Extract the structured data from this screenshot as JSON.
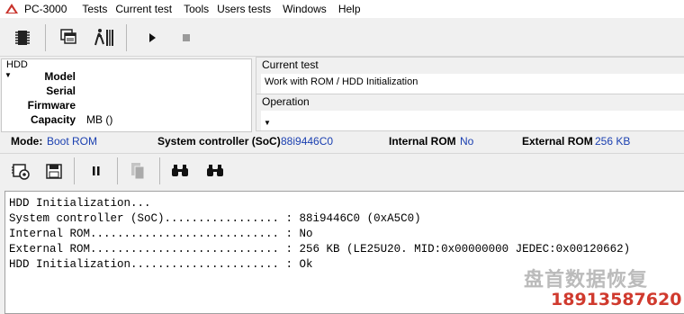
{
  "menubar": {
    "app_name": "PC-3000",
    "items": [
      "Tests",
      "Current test",
      "Tools",
      "Users tests",
      "Windows",
      "Help"
    ]
  },
  "toolbar1": {
    "icons": [
      "chip-icon",
      "windows-icon",
      "run-man-icon",
      "play-icon",
      "stop-icon"
    ]
  },
  "hdd": {
    "title": "HDD",
    "model_label": "Model",
    "serial_label": "Serial",
    "firmware_label": "Firmware",
    "capacity_label": "Capacity",
    "capacity_value": "MB ()"
  },
  "current_test": {
    "legend": "Current test",
    "value": "Work with ROM / HDD Initialization"
  },
  "operation": {
    "legend": "Operation"
  },
  "status": {
    "mode_label": "Mode:",
    "mode_value": "Boot ROM",
    "soc_label": "System controller (SoC)",
    "soc_value": "88i9446C0",
    "irom_label": "Internal ROM",
    "irom_value": "No",
    "erom_label": "External ROM",
    "erom_value": "256 KB"
  },
  "toolbar2": {
    "icons": [
      "settings-chip-icon",
      "disk-save-icon",
      "pause-icon",
      "copy-icon",
      "binoculars-icon",
      "binoculars-2-icon"
    ]
  },
  "log": {
    "lines": [
      "HDD Initialization...",
      "System controller (SoC)................. : 88i9446C0 (0xA5C0)",
      "Internal ROM............................ : No",
      "External ROM............................ : 256 KB (LE25U20. MID:0x00000000 JEDEC:0x00120662)",
      "HDD Initialization...................... : Ok"
    ]
  },
  "watermark": {
    "top": "盘首数据恢复",
    "bottom": "18913587620"
  },
  "colors": {
    "status_value": "#1a3fb0",
    "watermark_phone": "#d03a2e"
  }
}
